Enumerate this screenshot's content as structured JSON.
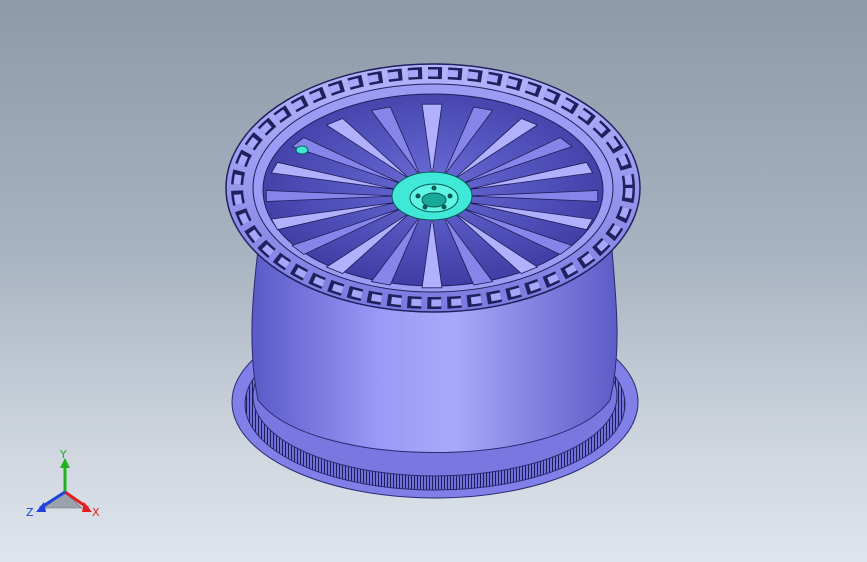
{
  "viewport": {
    "background_top": "#8e9aa9",
    "background_bottom": "#dfe5ec",
    "model": {
      "name": "alloy-wheel",
      "body_color": "#8c8cf0",
      "hub_color": "#38e0d0",
      "spoke_count": 20
    }
  },
  "triad": {
    "x_label": "X",
    "y_label": "Y",
    "z_label": "Z",
    "x_color": "#e02020",
    "y_color": "#20b020",
    "z_color": "#2040e0"
  }
}
